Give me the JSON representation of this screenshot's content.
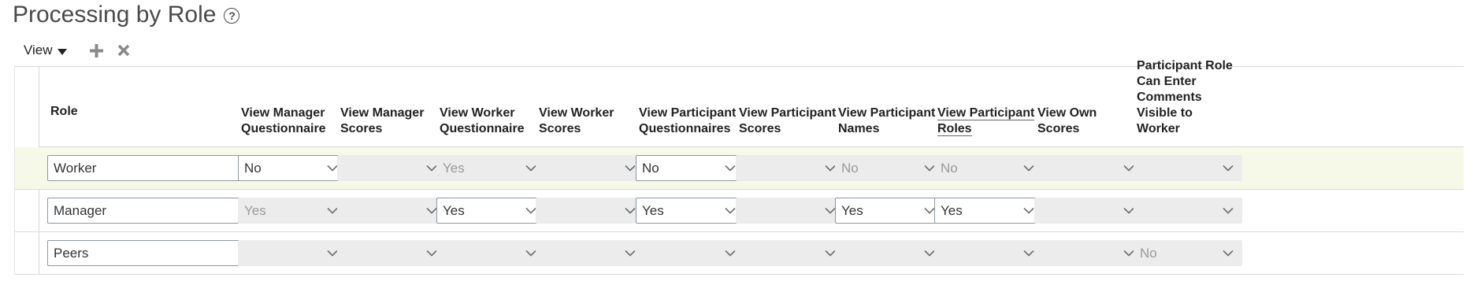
{
  "page": {
    "title": "Processing by Role"
  },
  "toolbar": {
    "view_label": "View"
  },
  "table": {
    "columns": [
      {
        "id": "role",
        "label": "Role"
      },
      {
        "id": "view_manager_questionnaire",
        "label": "View Manager Questionnaire"
      },
      {
        "id": "view_manager_scores",
        "label": "View Manager Scores"
      },
      {
        "id": "view_worker_questionnaire",
        "label": "View Worker Questionnaire"
      },
      {
        "id": "view_worker_scores",
        "label": "View Worker Scores"
      },
      {
        "id": "view_participant_questionnaires",
        "label": "View Participant Questionnaires"
      },
      {
        "id": "view_participant_scores",
        "label": "View Participant Scores"
      },
      {
        "id": "view_participant_names",
        "label": "View Participant Names"
      },
      {
        "id": "view_participant_roles",
        "label": "View Participant Roles"
      },
      {
        "id": "view_own_scores",
        "label": "View Own Scores"
      },
      {
        "id": "participant_role_comments",
        "label": "Participant Role Can Enter Comments Visible to Worker"
      }
    ],
    "rows": [
      {
        "cells": [
          {
            "value": "Worker",
            "enabled": true
          },
          {
            "value": "No",
            "enabled": true
          },
          {
            "value": "",
            "enabled": false
          },
          {
            "value": "Yes",
            "enabled": false
          },
          {
            "value": "",
            "enabled": false
          },
          {
            "value": "No",
            "enabled": true
          },
          {
            "value": "",
            "enabled": false
          },
          {
            "value": "No",
            "enabled": false
          },
          {
            "value": "No",
            "enabled": false
          },
          {
            "value": "",
            "enabled": false
          },
          {
            "value": "",
            "enabled": false
          }
        ]
      },
      {
        "cells": [
          {
            "value": "Manager",
            "enabled": true
          },
          {
            "value": "Yes",
            "enabled": false
          },
          {
            "value": "",
            "enabled": false
          },
          {
            "value": "Yes",
            "enabled": true
          },
          {
            "value": "",
            "enabled": false
          },
          {
            "value": "Yes",
            "enabled": true
          },
          {
            "value": "",
            "enabled": false
          },
          {
            "value": "Yes",
            "enabled": true
          },
          {
            "value": "Yes",
            "enabled": true
          },
          {
            "value": "",
            "enabled": false
          },
          {
            "value": "",
            "enabled": false
          }
        ]
      },
      {
        "cells": [
          {
            "value": "Peers",
            "enabled": true
          },
          {
            "value": "",
            "enabled": false
          },
          {
            "value": "",
            "enabled": false
          },
          {
            "value": "",
            "enabled": false
          },
          {
            "value": "",
            "enabled": false
          },
          {
            "value": "",
            "enabled": false
          },
          {
            "value": "",
            "enabled": false
          },
          {
            "value": "",
            "enabled": false
          },
          {
            "value": "",
            "enabled": false
          },
          {
            "value": "",
            "enabled": false
          },
          {
            "value": "No",
            "enabled": false
          }
        ]
      }
    ]
  }
}
